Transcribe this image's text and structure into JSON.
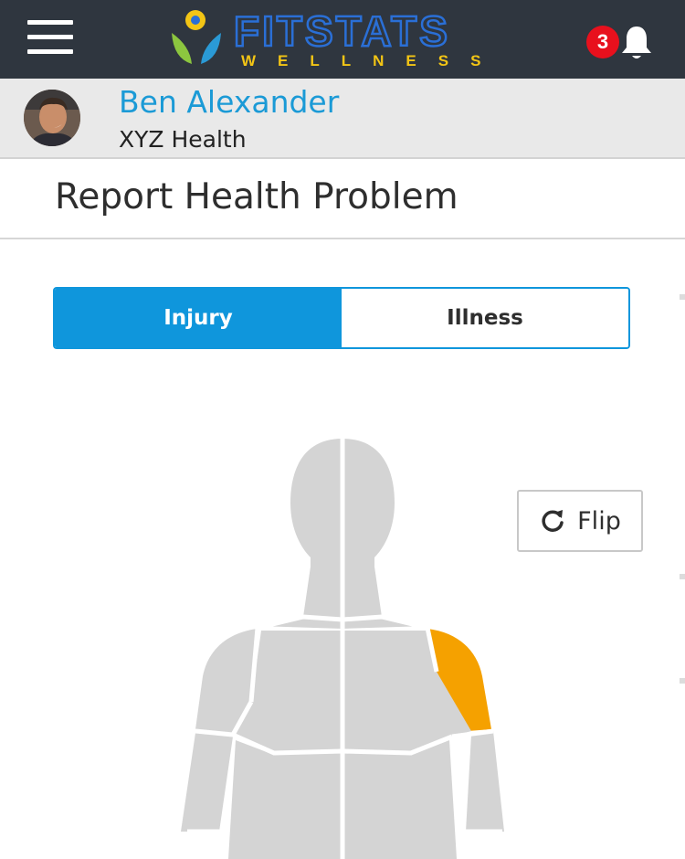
{
  "header": {
    "menu_icon": "hamburger-icon",
    "logo": {
      "word": "FITSTATS",
      "tagline": "WELLNESS",
      "brand_color": "#2a6fd6",
      "accent_colors": [
        "#f3c515",
        "#8cc63f",
        "#2a9ad6"
      ]
    },
    "notifications": {
      "count": "3",
      "icon": "bell-icon",
      "badge_color": "#e8101d"
    }
  },
  "user": {
    "name": "Ben Alexander",
    "organization": "XYZ Health",
    "avatar_icon": "user-photo"
  },
  "page": {
    "title": "Report Health Problem"
  },
  "tabs": [
    {
      "label": "Injury",
      "active": true
    },
    {
      "label": "Illness",
      "active": false
    }
  ],
  "body_map": {
    "view": "front",
    "selected_region": "left-shoulder",
    "highlight_color": "#f5a100",
    "base_color": "#d4d4d4",
    "flip_button": {
      "label": "Flip",
      "icon": "refresh-icon"
    }
  },
  "colors": {
    "topbar": "#2f363f",
    "accent": "#0f96dc",
    "name_color": "#1b9ad6"
  }
}
